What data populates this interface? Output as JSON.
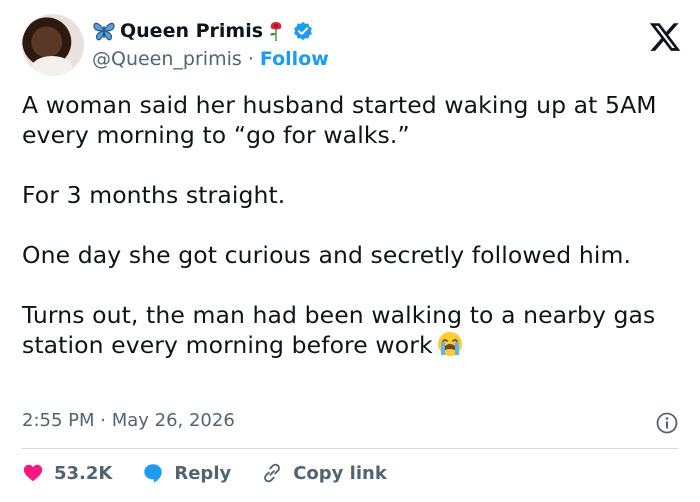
{
  "header": {
    "display_name": "Queen Primis",
    "handle": "@Queen_primis",
    "separator": "·",
    "follow_label": "Follow"
  },
  "tweet": {
    "paragraphs": [
      "A woman said her husband started waking up at 5AM every morning to “go for walks.”",
      "For 3 months straight.",
      "One day she got curious and secretly followed him.",
      "Turns out, the man had been walking to a nearby gas station every morning before work"
    ],
    "timestamp": "2:55 PM · May 26, 2026"
  },
  "actions": {
    "likes": "53.2K",
    "reply_label": "Reply",
    "copy_link_label": "Copy link"
  },
  "colors": {
    "accent": "#1d9bf0",
    "like": "#f91880",
    "muted": "#536471",
    "text": "#0f1419"
  },
  "icons": [
    "butterfly-emoji",
    "rose-emoji",
    "verified-badge",
    "x-logo",
    "crying-face-emoji",
    "info-icon",
    "heart-icon",
    "reply-bubble-icon",
    "link-icon"
  ]
}
